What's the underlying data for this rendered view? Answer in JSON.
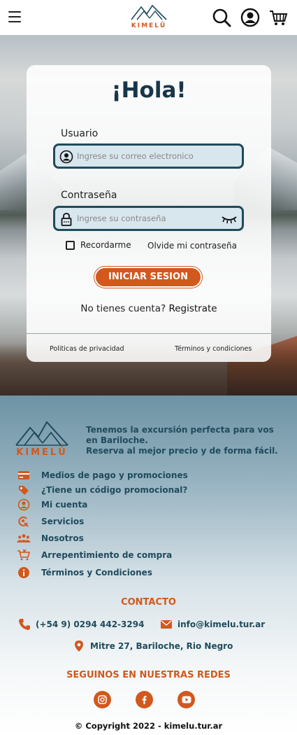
{
  "header": {
    "brand": "KIMELŪ",
    "icons": [
      "hamburger-menu-icon",
      "search-icon",
      "user-account-icon",
      "shopping-cart-icon"
    ]
  },
  "login": {
    "title": "¡Hola!",
    "user_label": "Usuario",
    "user_placeholder": "Ingrese su correo electronico",
    "password_label": "Contraseña",
    "password_placeholder": "Ingrese su contraseña",
    "remember_label": "Recordarme",
    "remember_checked": false,
    "forgot_label": "Olvide mi contraseña",
    "submit_label": "INICIAR SESION",
    "no_account_text": "No tienes cuenta?",
    "register_label": "Registrate",
    "privacy_label": "Politicas de privacidad",
    "terms_label": "Términos y condiciones"
  },
  "footer": {
    "brand": "KIMELŪ",
    "tagline_line1": "Tenemos la excursión perfecta para vos en Bariloche.",
    "tagline_line2": "Reserva al mejor precio y de forma fácil.",
    "menu": [
      {
        "label": "Medios de pago y promociones",
        "icon": "credit-card-icon"
      },
      {
        "label": "¿Tiene un código promocional?",
        "icon": "tag-icon"
      },
      {
        "label": "Mi cuenta",
        "icon": "user-circle-icon"
      },
      {
        "label": "Servicios",
        "icon": "service-icon"
      },
      {
        "label": "Nosotros",
        "icon": "people-icon"
      },
      {
        "label": "Arrepentimiento de compra",
        "icon": "cart-cancel-icon"
      },
      {
        "label": "Términos y Condiciones",
        "icon": "info-icon"
      }
    ],
    "contact_title": "CONTACTO",
    "phone": "(+54 9) 0294 442-3294",
    "email": "info@kimelu.tur.ar",
    "address": "Mitre 27, Bariloche, Rio Negro",
    "social_title": "SEGUINOS EN NUESTRAS REDES",
    "social": [
      "instagram-icon",
      "facebook-icon",
      "youtube-icon"
    ],
    "copyright": "© Copyright 2022 - kimelu.tur.ar"
  },
  "colors": {
    "accent": "#d2581d",
    "primary_dark": "#1f4b5c",
    "title": "#17364a"
  }
}
